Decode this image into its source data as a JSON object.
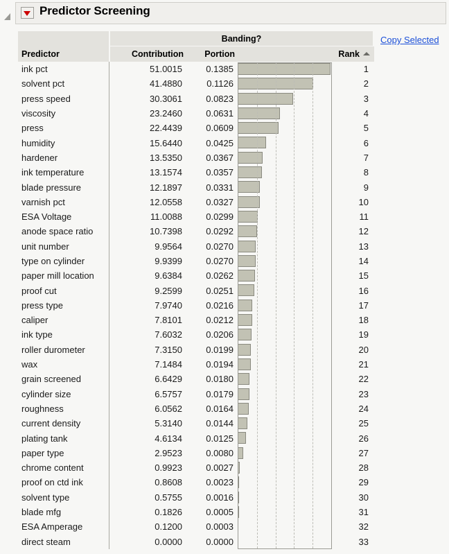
{
  "panel": {
    "title": "Predictor Screening",
    "disclosure_icon": "red-triangle-down-icon",
    "outline_icon": "outline-triangle-icon"
  },
  "actions": {
    "copy_selected_label": "Copy Selected"
  },
  "table": {
    "group_header": "Banding?",
    "columns": {
      "predictor": "Predictor",
      "contribution": "Contribution",
      "portion": "Portion",
      "chart": "",
      "rank": "Rank"
    },
    "sort_column": "Rank",
    "sort_icon": "caret-up-icon"
  },
  "chart_data": {
    "type": "bar",
    "title": "Predictor Screening",
    "xlabel": "",
    "ylabel": "Predictor",
    "categories": [
      "ink pct",
      "solvent pct",
      "press speed",
      "viscosity",
      "press",
      "humidity",
      "hardener",
      "ink temperature",
      "blade pressure",
      "varnish pct",
      "ESA Voltage",
      "anode space ratio",
      "unit number",
      "type on cylinder",
      "paper mill location",
      "proof cut",
      "press type",
      "caliper",
      "ink type",
      "roller durometer",
      "wax",
      "grain screened",
      "cylinder size",
      "roughness",
      "current density",
      "plating tank",
      "paper type",
      "chrome content",
      "proof on ctd ink",
      "solvent type",
      "blade mfg",
      "ESA Amperage",
      "direct steam"
    ],
    "values": [
      51.0015,
      41.488,
      30.3061,
      23.246,
      22.4439,
      15.644,
      13.535,
      13.1574,
      12.1897,
      12.0558,
      11.0088,
      10.7398,
      9.9564,
      9.9399,
      9.6384,
      9.2599,
      7.974,
      7.8101,
      7.6032,
      7.315,
      7.1484,
      6.6429,
      6.5757,
      6.0562,
      5.314,
      4.6134,
      2.9523,
      0.9923,
      0.8608,
      0.5755,
      0.1826,
      0.12,
      0.0
    ],
    "xlim": [
      0,
      51.0015
    ],
    "grid": true,
    "gridline_count": 4,
    "legend": "none",
    "bar_color": "#c2c2b4",
    "bar_border_color": "#8a8a80"
  },
  "rows": [
    {
      "predictor": "ink pct",
      "contribution": "51.0015",
      "portion": "0.1385",
      "value": 51.0015,
      "rank": "1"
    },
    {
      "predictor": "solvent pct",
      "contribution": "41.4880",
      "portion": "0.1126",
      "value": 41.488,
      "rank": "2"
    },
    {
      "predictor": "press speed",
      "contribution": "30.3061",
      "portion": "0.0823",
      "value": 30.3061,
      "rank": "3"
    },
    {
      "predictor": "viscosity",
      "contribution": "23.2460",
      "portion": "0.0631",
      "value": 23.246,
      "rank": "4"
    },
    {
      "predictor": "press",
      "contribution": "22.4439",
      "portion": "0.0609",
      "value": 22.4439,
      "rank": "5"
    },
    {
      "predictor": "humidity",
      "contribution": "15.6440",
      "portion": "0.0425",
      "value": 15.644,
      "rank": "6"
    },
    {
      "predictor": "hardener",
      "contribution": "13.5350",
      "portion": "0.0367",
      "value": 13.535,
      "rank": "7"
    },
    {
      "predictor": "ink temperature",
      "contribution": "13.1574",
      "portion": "0.0357",
      "value": 13.1574,
      "rank": "8"
    },
    {
      "predictor": "blade pressure",
      "contribution": "12.1897",
      "portion": "0.0331",
      "value": 12.1897,
      "rank": "9"
    },
    {
      "predictor": "varnish pct",
      "contribution": "12.0558",
      "portion": "0.0327",
      "value": 12.0558,
      "rank": "10"
    },
    {
      "predictor": "ESA Voltage",
      "contribution": "11.0088",
      "portion": "0.0299",
      "value": 11.0088,
      "rank": "11"
    },
    {
      "predictor": "anode space ratio",
      "contribution": "10.7398",
      "portion": "0.0292",
      "value": 10.7398,
      "rank": "12"
    },
    {
      "predictor": "unit number",
      "contribution": "9.9564",
      "portion": "0.0270",
      "value": 9.9564,
      "rank": "13"
    },
    {
      "predictor": "type on cylinder",
      "contribution": "9.9399",
      "portion": "0.0270",
      "value": 9.9399,
      "rank": "14"
    },
    {
      "predictor": "paper mill location",
      "contribution": "9.6384",
      "portion": "0.0262",
      "value": 9.6384,
      "rank": "15"
    },
    {
      "predictor": "proof cut",
      "contribution": "9.2599",
      "portion": "0.0251",
      "value": 9.2599,
      "rank": "16"
    },
    {
      "predictor": "press type",
      "contribution": "7.9740",
      "portion": "0.0216",
      "value": 7.974,
      "rank": "17"
    },
    {
      "predictor": "caliper",
      "contribution": "7.8101",
      "portion": "0.0212",
      "value": 7.8101,
      "rank": "18"
    },
    {
      "predictor": "ink type",
      "contribution": "7.6032",
      "portion": "0.0206",
      "value": 7.6032,
      "rank": "19"
    },
    {
      "predictor": "roller durometer",
      "contribution": "7.3150",
      "portion": "0.0199",
      "value": 7.315,
      "rank": "20"
    },
    {
      "predictor": "wax",
      "contribution": "7.1484",
      "portion": "0.0194",
      "value": 7.1484,
      "rank": "21"
    },
    {
      "predictor": "grain screened",
      "contribution": "6.6429",
      "portion": "0.0180",
      "value": 6.6429,
      "rank": "22"
    },
    {
      "predictor": "cylinder size",
      "contribution": "6.5757",
      "portion": "0.0179",
      "value": 6.5757,
      "rank": "23"
    },
    {
      "predictor": "roughness",
      "contribution": "6.0562",
      "portion": "0.0164",
      "value": 6.0562,
      "rank": "24"
    },
    {
      "predictor": "current density",
      "contribution": "5.3140",
      "portion": "0.0144",
      "value": 5.314,
      "rank": "25"
    },
    {
      "predictor": "plating tank",
      "contribution": "4.6134",
      "portion": "0.0125",
      "value": 4.6134,
      "rank": "26"
    },
    {
      "predictor": "paper type",
      "contribution": "2.9523",
      "portion": "0.0080",
      "value": 2.9523,
      "rank": "27"
    },
    {
      "predictor": "chrome content",
      "contribution": "0.9923",
      "portion": "0.0027",
      "value": 0.9923,
      "rank": "28"
    },
    {
      "predictor": "proof on ctd ink",
      "contribution": "0.8608",
      "portion": "0.0023",
      "value": 0.8608,
      "rank": "29"
    },
    {
      "predictor": "solvent type",
      "contribution": "0.5755",
      "portion": "0.0016",
      "value": 0.5755,
      "rank": "30"
    },
    {
      "predictor": "blade mfg",
      "contribution": "0.1826",
      "portion": "0.0005",
      "value": 0.1826,
      "rank": "31"
    },
    {
      "predictor": "ESA Amperage",
      "contribution": "0.1200",
      "portion": "0.0003",
      "value": 0.12,
      "rank": "32"
    },
    {
      "predictor": "direct steam",
      "contribution": "0.0000",
      "portion": "0.0000",
      "value": 0.0,
      "rank": "33"
    }
  ]
}
